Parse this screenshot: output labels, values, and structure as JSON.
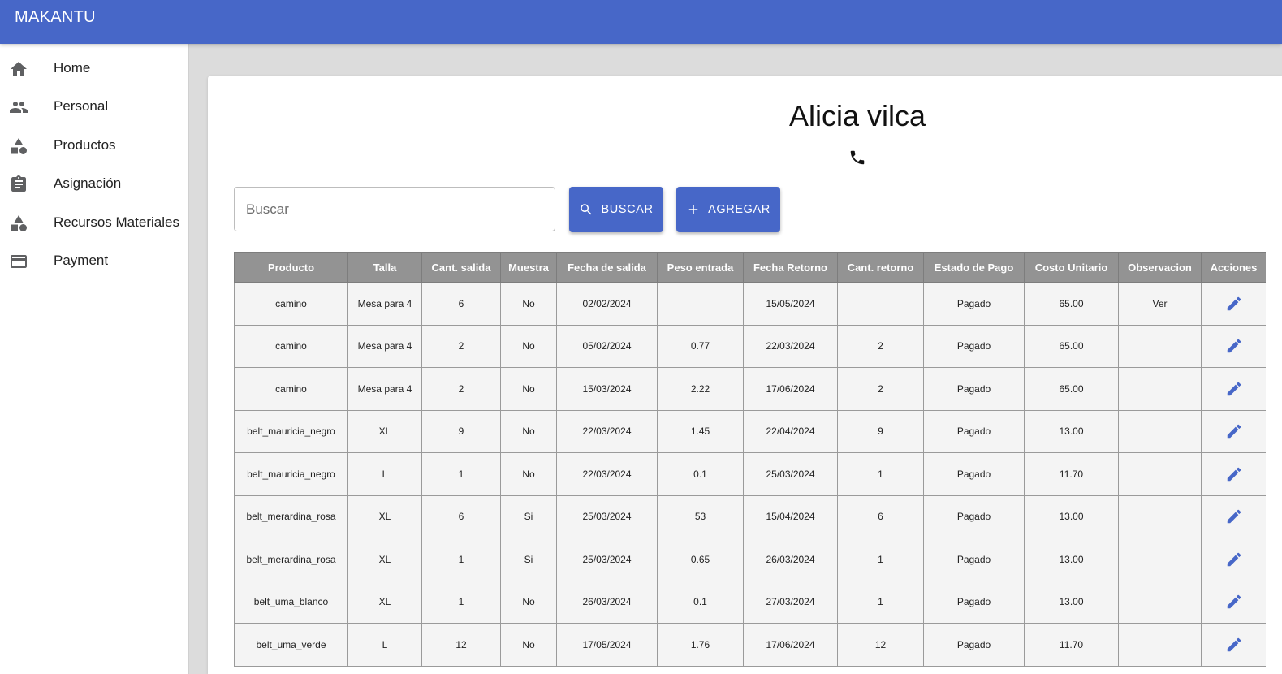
{
  "app": {
    "title": "MAKANTU"
  },
  "sidebar": {
    "items": [
      {
        "label": "Home",
        "icon": "home-icon"
      },
      {
        "label": "Personal",
        "icon": "people-icon"
      },
      {
        "label": "Productos",
        "icon": "category-icon"
      },
      {
        "label": "Asignación",
        "icon": "assignment-icon"
      },
      {
        "label": "Recursos Materiales",
        "icon": "category-icon"
      },
      {
        "label": "Payment",
        "icon": "credit-card-icon"
      }
    ]
  },
  "person": {
    "name": "Alicia vilca",
    "phone_icon": "phone-icon"
  },
  "search": {
    "placeholder": "Buscar",
    "value": ""
  },
  "buttons": {
    "search_label": "BUSCAR",
    "add_label": "AGREGAR"
  },
  "table": {
    "headers": [
      "Producto",
      "Talla",
      "Cant. salida",
      "Muestra",
      "Fecha de salida",
      "Peso entrada",
      "Fecha Retorno",
      "Cant. retorno",
      "Estado de Pago",
      "Costo Unitario",
      "Observacion",
      "Acciones"
    ],
    "rows": [
      [
        "camino",
        "Mesa para 4",
        "6",
        "No",
        "02/02/2024",
        "",
        "15/05/2024",
        "",
        "Pagado",
        "65.00",
        "Ver"
      ],
      [
        "camino",
        "Mesa para 4",
        "2",
        "No",
        "05/02/2024",
        "0.77",
        "22/03/2024",
        "2",
        "Pagado",
        "65.00",
        ""
      ],
      [
        "camino",
        "Mesa para 4",
        "2",
        "No",
        "15/03/2024",
        "2.22",
        "17/06/2024",
        "2",
        "Pagado",
        "65.00",
        ""
      ],
      [
        "belt_mauricia_negro",
        "XL",
        "9",
        "No",
        "22/03/2024",
        "1.45",
        "22/04/2024",
        "9",
        "Pagado",
        "13.00",
        ""
      ],
      [
        "belt_mauricia_negro",
        "L",
        "1",
        "No",
        "22/03/2024",
        "0.1",
        "25/03/2024",
        "1",
        "Pagado",
        "11.70",
        ""
      ],
      [
        "belt_merardina_rosa",
        "XL",
        "6",
        "Si",
        "25/03/2024",
        "53",
        "15/04/2024",
        "6",
        "Pagado",
        "13.00",
        ""
      ],
      [
        "belt_merardina_rosa",
        "XL",
        "1",
        "Si",
        "25/03/2024",
        "0.65",
        "26/03/2024",
        "1",
        "Pagado",
        "13.00",
        ""
      ],
      [
        "belt_uma_blanco",
        "XL",
        "1",
        "No",
        "26/03/2024",
        "0.1",
        "27/03/2024",
        "1",
        "Pagado",
        "13.00",
        ""
      ],
      [
        "belt_uma_verde",
        "L",
        "12",
        "No",
        "17/05/2024",
        "1.76",
        "17/06/2024",
        "12",
        "Pagado",
        "11.70",
        ""
      ]
    ],
    "action_icon": "edit-icon"
  },
  "colors": {
    "primary": "#4767c8",
    "header_bg": "#939393",
    "row_bg": "#f4f4f4",
    "page_bg": "#dcdcdc"
  }
}
